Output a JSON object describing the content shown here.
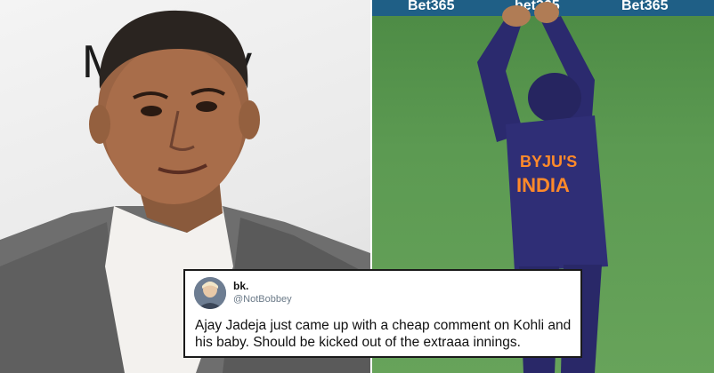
{
  "left_photo": {
    "backdrop_text": "M    ed by",
    "subject": "man-in-grey-suit-portrait"
  },
  "right_photo": {
    "banner_texts": [
      "Bet365",
      "bet365",
      "Bet365"
    ],
    "jersey_texts": [
      "BYJU'S",
      "INDIA"
    ],
    "subject": "cricketer-catching-ball"
  },
  "tweet": {
    "name": "bk.",
    "handle": "@NotBobbey",
    "text": "Ajay Jadeja just came up with a cheap comment on Kohli and his baby. Should be kicked out of the extraaa innings."
  },
  "colors": {
    "tweet_border": "#1a1a1a",
    "grass": "#5c9a52",
    "jersey": "#2b2a6e"
  }
}
